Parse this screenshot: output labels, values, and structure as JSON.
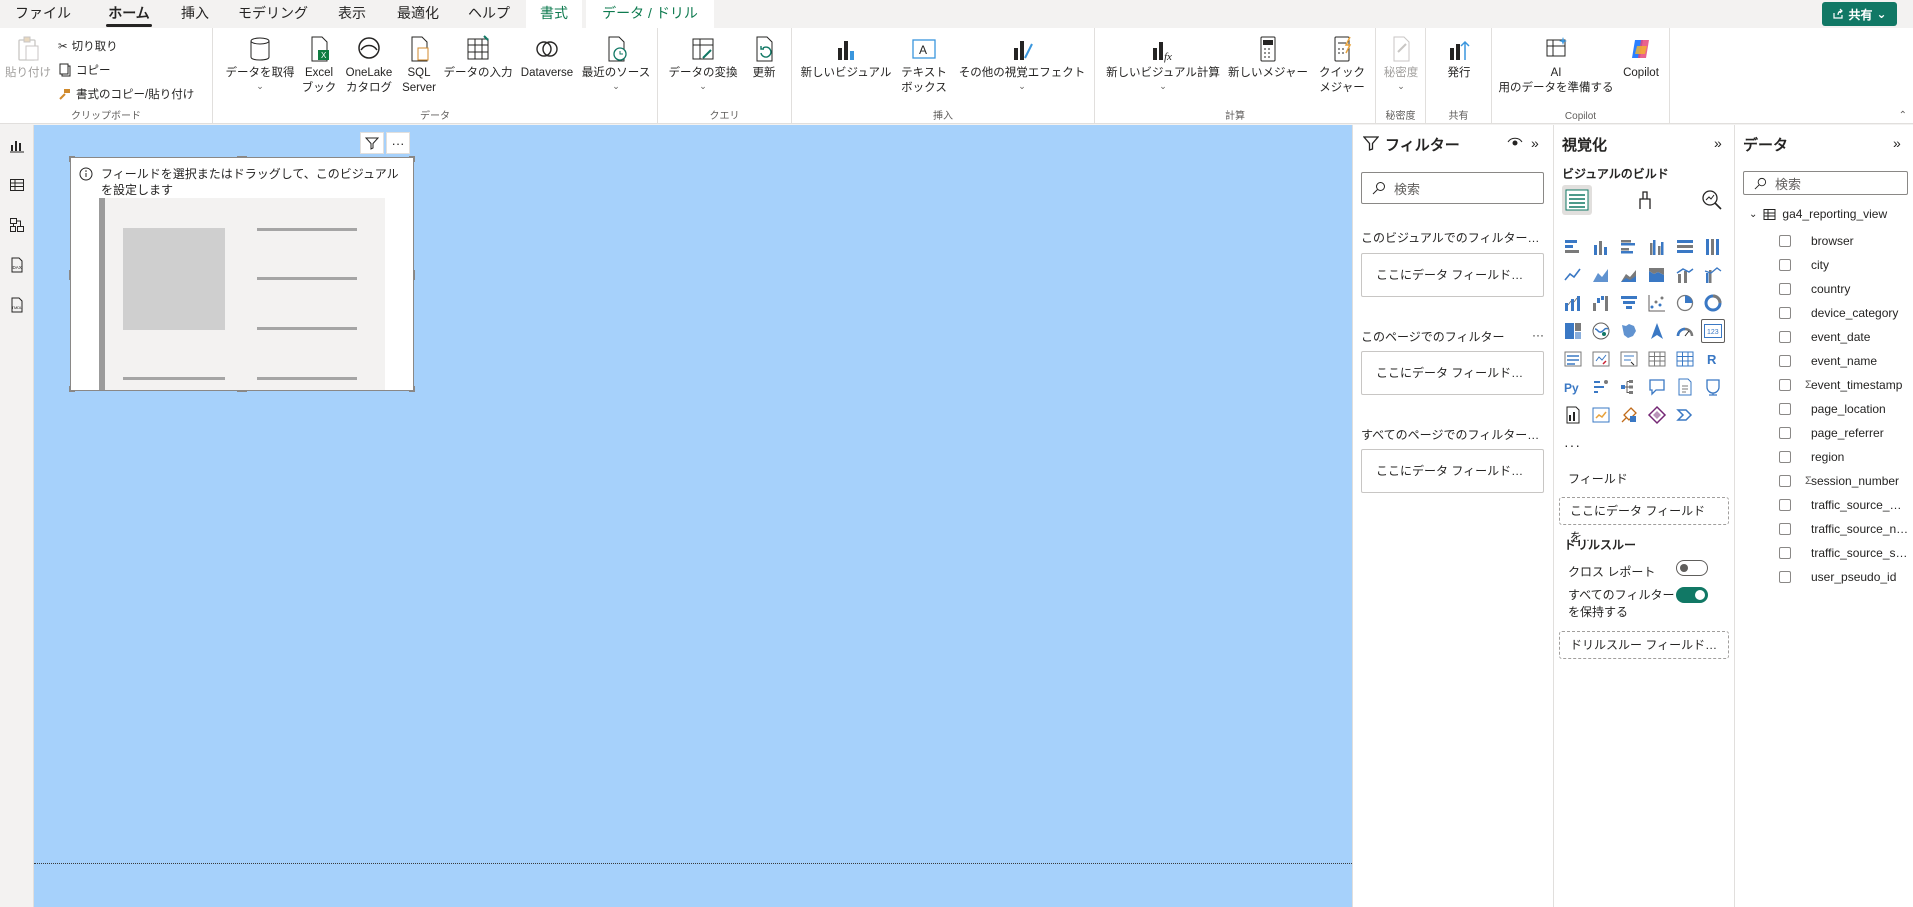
{
  "menu": {
    "tabs": [
      {
        "label": "ファイル"
      },
      {
        "label": "ホーム"
      },
      {
        "label": "挿入"
      },
      {
        "label": "モデリング"
      },
      {
        "label": "表示"
      },
      {
        "label": "最適化"
      },
      {
        "label": "ヘルプ"
      },
      {
        "label": "書式"
      },
      {
        "label": "データ / ドリル"
      }
    ],
    "share_label": "共有"
  },
  "ribbon": {
    "clipboard": {
      "paste": "貼り付け",
      "cut": "切り取り",
      "copy": "コピー",
      "format_painter": "書式のコピー/貼り付け",
      "label": "クリップボード"
    },
    "data": {
      "get_data": "データを取得",
      "excel": "Excel\nブック",
      "onelake": "OneLake\nカタログ",
      "sql": "SQL\nServer",
      "enter": "データの入力",
      "dataverse": "Dataverse",
      "recent": "最近のソース",
      "label": "データ"
    },
    "query": {
      "transform": "データの変換",
      "refresh": "更新",
      "label": "クエリ"
    },
    "insert": {
      "new_visual": "新しいビジュアル",
      "textbox": "テキスト\nボックス",
      "more_visuals": "その他の視覚エフェクト",
      "label": "挿入"
    },
    "calc": {
      "visual_calc": "新しいビジュアル計算",
      "new_measure": "新しいメジャー",
      "quick_measure": "クイック\nメジャー",
      "label": "計算"
    },
    "sensitivity": {
      "btn": "秘密度",
      "label": "秘密度"
    },
    "share": {
      "publish": "発行",
      "label": "共有"
    },
    "copilot": {
      "ai_prep": "AI\n用のデータを準備する",
      "copilot": "Copilot",
      "label": "Copilot"
    }
  },
  "canvas": {
    "visual_hint": "フィールドを選択またはドラッグして、このビジュアルを設定します"
  },
  "filters": {
    "title": "フィルター",
    "search_placeholder": "検索",
    "sections": [
      {
        "title": "このビジュアルでのフィルター…",
        "well": "ここにデータ フィールド…"
      },
      {
        "title": "このページでのフィルター",
        "well": "ここにデータ フィールド…"
      },
      {
        "title": "すべてのページでのフィルター…",
        "well": "ここにデータ フィールド…"
      }
    ]
  },
  "visualizations": {
    "title": "視覚化",
    "subtitle": "ビジュアルのビルド",
    "fields_label": "フィールド",
    "fields_well": "ここにデータ フィールドを…",
    "drillthrough_label": "ドリルスルー",
    "cross_report": "クロス レポート",
    "keep_filters": "すべてのフィルター\nを保持する",
    "drill_well": "ドリルスルー フィールド…",
    "more": "···",
    "icons": [
      "stacked-bar",
      "stacked-column",
      "clustered-bar",
      "clustered-column",
      "100-bar",
      "100-column",
      "line",
      "area",
      "stacked-area",
      "100-area",
      "line-column",
      "line-clustered",
      "ribbon",
      "waterfall",
      "funnel",
      "scatter",
      "pie",
      "donut",
      "treemap",
      "map",
      "filled-map",
      "azure-map",
      "gauge",
      "card",
      "multi-card",
      "kpi",
      "slicer",
      "table",
      "matrix",
      "r-visual",
      "python",
      "key-influencers",
      "decomposition",
      "qa",
      "narrative",
      "paginated",
      "metrics",
      "power-apps",
      "power-automate",
      "more-1",
      "more-2",
      "arrow-chevron"
    ]
  },
  "data": {
    "title": "データ",
    "search_placeholder": "検索",
    "table": "ga4_reporting_view",
    "fields": [
      {
        "name": "browser",
        "sigma": false
      },
      {
        "name": "city",
        "sigma": false
      },
      {
        "name": "country",
        "sigma": false
      },
      {
        "name": "device_category",
        "sigma": false
      },
      {
        "name": "event_date",
        "sigma": false
      },
      {
        "name": "event_name",
        "sigma": false
      },
      {
        "name": "event_timestamp",
        "sigma": true
      },
      {
        "name": "page_location",
        "sigma": false
      },
      {
        "name": "page_referrer",
        "sigma": false
      },
      {
        "name": "region",
        "sigma": false
      },
      {
        "name": "session_number",
        "sigma": true
      },
      {
        "name": "traffic_source_…",
        "sigma": false
      },
      {
        "name": "traffic_source_n…",
        "sigma": false
      },
      {
        "name": "traffic_source_s…",
        "sigma": false
      },
      {
        "name": "user_pseudo_id",
        "sigma": false
      }
    ]
  }
}
